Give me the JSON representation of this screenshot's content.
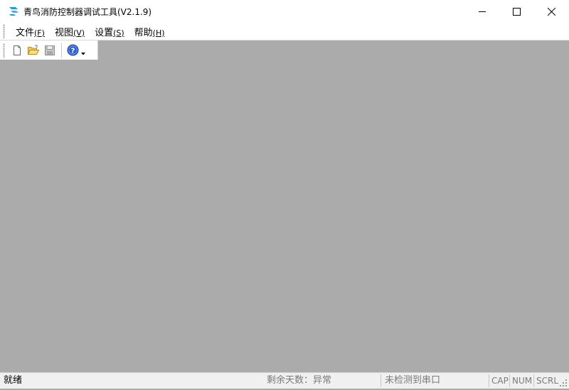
{
  "window": {
    "title": "青鸟消防控制器调试工具(V2.1.9)",
    "controls": [
      "minimize",
      "maximize",
      "close"
    ]
  },
  "menubar": {
    "items": [
      {
        "label": "文件",
        "mnemonic": "(F)"
      },
      {
        "label": "视图",
        "mnemonic": "(V)"
      },
      {
        "label": "设置",
        "mnemonic": "(S)"
      },
      {
        "label": "帮助",
        "mnemonic": "(H)"
      }
    ]
  },
  "toolbar": {
    "buttons": [
      "new-file-icon",
      "open-folder-icon",
      "save-disk-icon",
      "help-icon"
    ]
  },
  "statusbar": {
    "ready": "就绪",
    "remaining_days": "剩余天数：异常",
    "serial_status": "未检测到串口",
    "cap": "CAP",
    "num": "NUM",
    "scrl": "SCRL"
  },
  "colors": {
    "workspace": "#ababab",
    "accent_icon": "#1e9ad6",
    "help_icon": "#2a5fcf"
  }
}
